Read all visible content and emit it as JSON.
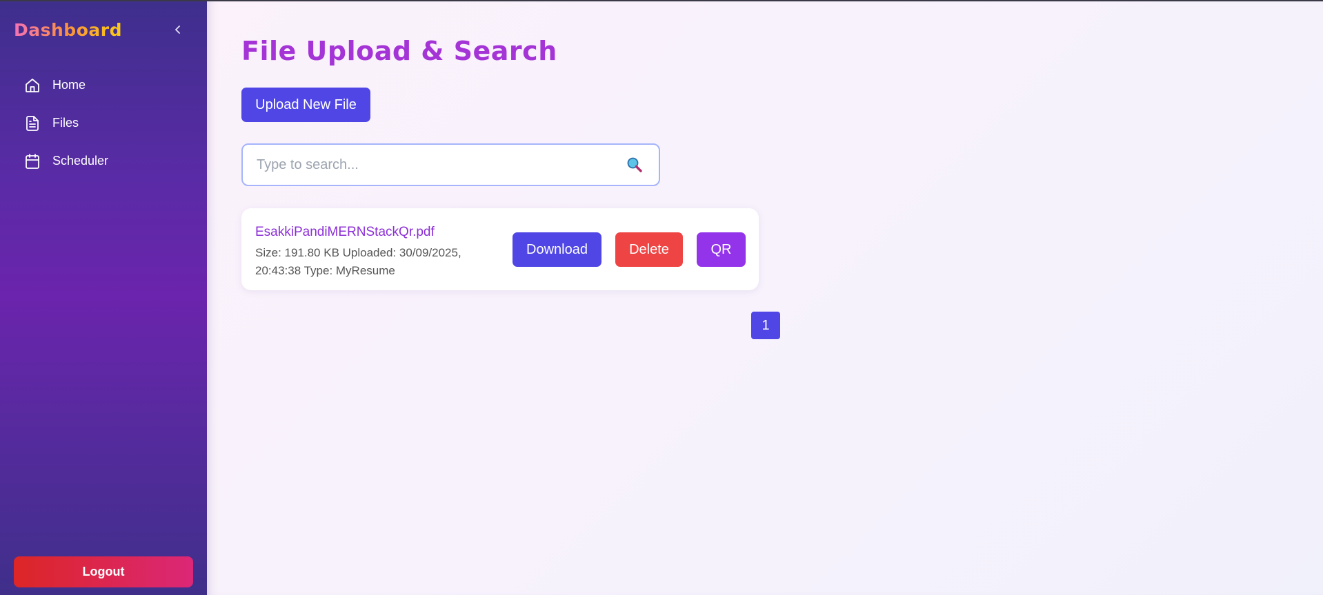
{
  "sidebar": {
    "brand": "Dashboard",
    "items": [
      {
        "label": "Home",
        "icon": "home-icon"
      },
      {
        "label": "Files",
        "icon": "file-icon"
      },
      {
        "label": "Scheduler",
        "icon": "calendar-icon"
      }
    ],
    "logout_label": "Logout"
  },
  "main": {
    "title": "File Upload & Search",
    "upload_label": "Upload New File",
    "search": {
      "placeholder": "Type to search...",
      "value": ""
    },
    "files": [
      {
        "name": "EsakkiPandiMERNStackQr.pdf",
        "meta": "Size: 191.80 KB Uploaded: 30/09/2025, 20:43:38 Type: MyResume",
        "download_label": "Download",
        "delete_label": "Delete",
        "qr_label": "QR"
      }
    ],
    "pagination": {
      "current": "1"
    }
  },
  "colors": {
    "primary": "#4f46e5",
    "danger": "#ef4444",
    "accent": "#9333ea",
    "title": "#a434d6"
  }
}
